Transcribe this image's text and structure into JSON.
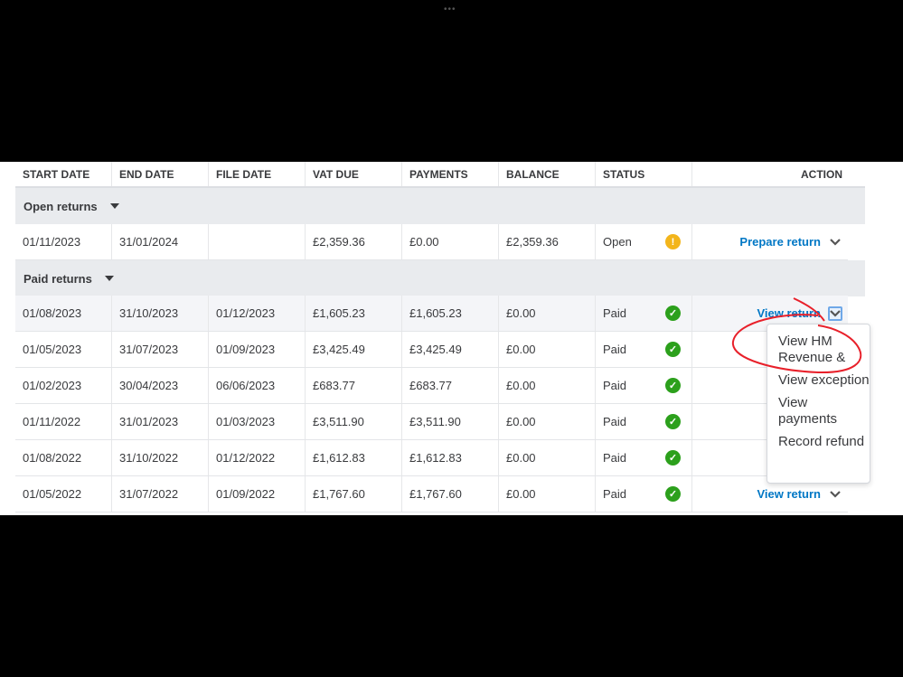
{
  "columns": [
    "START DATE",
    "END DATE",
    "FILE DATE",
    "VAT DUE",
    "PAYMENTS",
    "BALANCE",
    "STATUS",
    "ACTION"
  ],
  "groups": {
    "open": "Open returns",
    "paid": "Paid returns"
  },
  "open_rows": [
    {
      "start": "01/11/2023",
      "end": "31/01/2024",
      "file": "",
      "vat": "£2,359.36",
      "payments": "£0.00",
      "balance": "£2,359.36",
      "status": "Open",
      "action": "Prepare return"
    }
  ],
  "paid_rows": [
    {
      "start": "01/08/2023",
      "end": "31/10/2023",
      "file": "01/12/2023",
      "vat": "£1,605.23",
      "payments": "£1,605.23",
      "balance": "£0.00",
      "status": "Paid",
      "action": "View return"
    },
    {
      "start": "01/05/2023",
      "end": "31/07/2023",
      "file": "01/09/2023",
      "vat": "£3,425.49",
      "payments": "£3,425.49",
      "balance": "£0.00",
      "status": "Paid",
      "action": ""
    },
    {
      "start": "01/02/2023",
      "end": "30/04/2023",
      "file": "06/06/2023",
      "vat": "£683.77",
      "payments": "£683.77",
      "balance": "£0.00",
      "status": "Paid",
      "action": ""
    },
    {
      "start": "01/11/2022",
      "end": "31/01/2023",
      "file": "01/03/2023",
      "vat": "£3,511.90",
      "payments": "£3,511.90",
      "balance": "£0.00",
      "status": "Paid",
      "action": ""
    },
    {
      "start": "01/08/2022",
      "end": "31/10/2022",
      "file": "01/12/2022",
      "vat": "£1,612.83",
      "payments": "£1,612.83",
      "balance": "£0.00",
      "status": "Paid",
      "action": ""
    },
    {
      "start": "01/05/2022",
      "end": "31/07/2022",
      "file": "01/09/2022",
      "vat": "£1,767.60",
      "payments": "£1,767.60",
      "balance": "£0.00",
      "status": "Paid",
      "action": "View return"
    }
  ],
  "menu": [
    "View HM Revenue &",
    "View exception",
    "View payments",
    "Record refund"
  ],
  "top_dots": "•••"
}
